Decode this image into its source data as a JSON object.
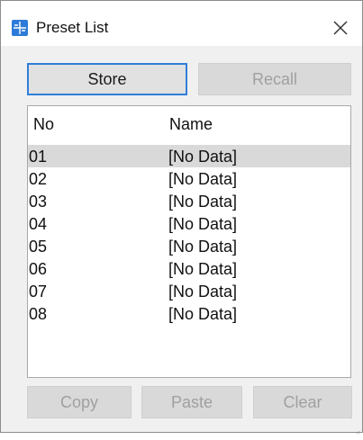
{
  "window": {
    "title": "Preset List",
    "app_icon": "preset-app-icon",
    "close_icon": "close-icon"
  },
  "buttons": {
    "store": "Store",
    "recall": "Recall",
    "copy": "Copy",
    "paste": "Paste",
    "clear": "Clear"
  },
  "table": {
    "columns": [
      "No",
      "Name"
    ],
    "selected_row": 0,
    "rows": [
      {
        "no": "01",
        "name": "[No Data]"
      },
      {
        "no": "02",
        "name": "[No Data]"
      },
      {
        "no": "03",
        "name": "[No Data]"
      },
      {
        "no": "04",
        "name": "[No Data]"
      },
      {
        "no": "05",
        "name": "[No Data]"
      },
      {
        "no": "06",
        "name": "[No Data]"
      },
      {
        "no": "07",
        "name": "[No Data]"
      },
      {
        "no": "08",
        "name": "[No Data]"
      }
    ]
  },
  "colors": {
    "accent": "#2f7ed8",
    "window_background": "#f0f0f0",
    "disabled_button": "#d9d9d9",
    "selected_row": "#d9d9d9"
  }
}
